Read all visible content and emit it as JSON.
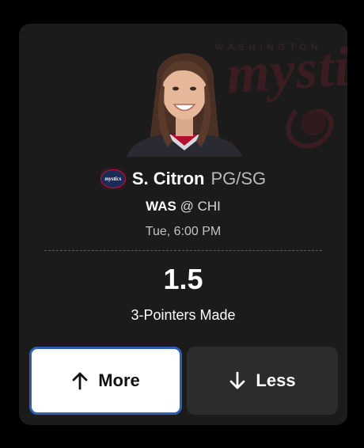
{
  "player": {
    "name": "S. Citron",
    "position": "PG/SG",
    "team_logo_text": "mystics"
  },
  "watermark": {
    "arc_text": "WASHINGTON",
    "word": "mystics"
  },
  "matchup": {
    "team": "WAS",
    "separator": "@",
    "opponent": "CHI"
  },
  "game_time": "Tue, 6:00 PM",
  "projection": {
    "line": "1.5",
    "stat": "3-Pointers Made"
  },
  "buttons": {
    "more_label": "More",
    "less_label": "Less"
  },
  "colors": {
    "card_bg": "#1b1b1b",
    "selected_border": "#2f5fb3",
    "less_bg": "#2c2c2c"
  },
  "icons": [
    "team-logo-icon",
    "arrow-up-icon",
    "arrow-down-icon"
  ]
}
